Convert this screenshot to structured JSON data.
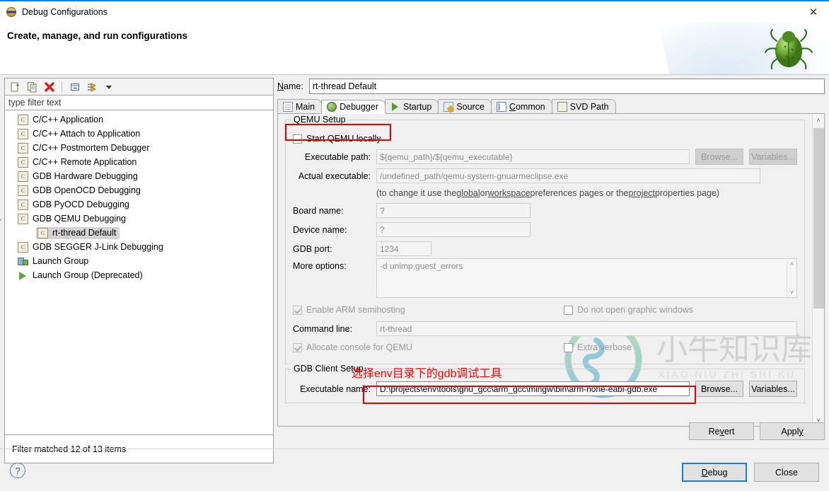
{
  "window": {
    "title": "Debug Configurations",
    "close_label": "✕",
    "header_title": "Create, manage, and run configurations",
    "header_icon": "bug-icon"
  },
  "left_panel": {
    "toolbar": [
      {
        "name": "new-configuration-icon",
        "label": ""
      },
      {
        "name": "duplicate-configuration-icon",
        "label": ""
      },
      {
        "name": "delete-configuration-icon",
        "label": ""
      },
      {
        "name": "collapse-all-icon",
        "label": ""
      },
      {
        "name": "filter-icon",
        "label": ""
      },
      {
        "name": "dropdown-arrow-icon",
        "label": ""
      }
    ],
    "filter": {
      "placeholder": "type filter text",
      "value": ""
    },
    "tree": [
      {
        "label": "C/C++ Application",
        "icon": "c-config-icon",
        "indent": 0,
        "selected": false,
        "expander": ""
      },
      {
        "label": "C/C++ Attach to Application",
        "icon": "c-config-icon",
        "indent": 0,
        "selected": false,
        "expander": ""
      },
      {
        "label": "C/C++ Postmortem Debugger",
        "icon": "c-config-icon",
        "indent": 0,
        "selected": false,
        "expander": ""
      },
      {
        "label": "C/C++ Remote Application",
        "icon": "c-config-icon",
        "indent": 0,
        "selected": false,
        "expander": ""
      },
      {
        "label": "GDB Hardware Debugging",
        "icon": "c-config-icon",
        "indent": 0,
        "selected": false,
        "expander": ""
      },
      {
        "label": "GDB OpenOCD Debugging",
        "icon": "c-config-icon",
        "indent": 0,
        "selected": false,
        "expander": ""
      },
      {
        "label": "GDB PyOCD Debugging",
        "icon": "c-config-icon",
        "indent": 0,
        "selected": false,
        "expander": ""
      },
      {
        "label": "GDB QEMU Debugging",
        "icon": "c-config-icon",
        "indent": 0,
        "selected": false,
        "expander": "expanded"
      },
      {
        "label": "rt-thread Default",
        "icon": "c-config-icon",
        "indent": 1,
        "selected": true,
        "expander": ""
      },
      {
        "label": "GDB SEGGER J-Link Debugging",
        "icon": "c-config-icon",
        "indent": 0,
        "selected": false,
        "expander": ""
      },
      {
        "label": "Launch Group",
        "icon": "launch-group-icon",
        "indent": 0,
        "selected": false,
        "expander": ""
      },
      {
        "label": "Launch Group (Deprecated)",
        "icon": "launch-group-deprecated-icon",
        "indent": 0,
        "selected": false,
        "expander": ""
      }
    ],
    "status": "Filter matched 12 of 13 items"
  },
  "right_panel": {
    "name_label": "Name:",
    "name_label_accel": "N",
    "name_value": "rt-thread Default",
    "tabs": [
      {
        "label": "Main",
        "icon": "document-icon",
        "active": false,
        "accel": ""
      },
      {
        "label": "Debugger",
        "icon": "bug-icon",
        "active": true,
        "accel": ""
      },
      {
        "label": "Startup",
        "icon": "play-icon",
        "active": false,
        "accel": ""
      },
      {
        "label": "Source",
        "icon": "source-icon",
        "active": false,
        "accel": ""
      },
      {
        "label": "Common",
        "icon": "common-icon",
        "active": false,
        "accel": "C"
      },
      {
        "label": "SVD Path",
        "icon": "svd-icon",
        "active": false,
        "accel": ""
      }
    ],
    "qemu_setup": {
      "group_label": "QEMU Setup",
      "start_qemu_locally": {
        "label": "Start QEMU locally",
        "checked": false
      },
      "executable_path": {
        "label": "Executable path:",
        "value": "${qemu_path}/${qemu_executable}"
      },
      "browse_label": "Browse...",
      "variables_label": "Variables...",
      "actual_executable": {
        "label": "Actual executable:",
        "value": "/undefined_path/qemu-system-gnuarmeclipse.exe"
      },
      "hint_prefix": "(to change it use the ",
      "hint_link1": "global",
      "hint_mid1": " or ",
      "hint_link2": "workspace",
      "hint_mid2": " preferences pages or the ",
      "hint_link3": "project",
      "hint_suffix": " properties page)",
      "board_name": {
        "label": "Board name:",
        "value": "?"
      },
      "device_name": {
        "label": "Device name:",
        "value": "?"
      },
      "gdb_port": {
        "label": "GDB port:",
        "value": "1234"
      },
      "more_options": {
        "label": "More options:",
        "value": "-d unimp,guest_errors"
      },
      "enable_arm_semihosting": {
        "label": "Enable ARM semihosting",
        "checked": true
      },
      "do_not_open_graphic_windows": {
        "label": "Do not open graphic windows",
        "checked": false
      },
      "command_line": {
        "label": "Command line:",
        "value": "rt-thread"
      },
      "allocate_console": {
        "label": "Allocate console for QEMU",
        "checked": true
      },
      "extra_verbose": {
        "label": "Extra verbose",
        "checked": false
      }
    },
    "gdb_client_setup": {
      "group_label": "GDB Client Setup",
      "executable_name": {
        "label": "Executable name:",
        "value": "D:\\projects\\env\\tools\\gnu_gcc\\arm_gcc\\mingw\\bin\\arm-none-eabi-gdb.exe"
      },
      "browse_label": "Browse...",
      "variables_label": "Variables..."
    }
  },
  "annotations": {
    "red_note": "选择env目录下的gdb调试工具",
    "red_color": "#ff0000"
  },
  "watermark": {
    "cn_text": "小牛知识库",
    "pinyin_text": "XIAO NIU ZHI SHI KU"
  },
  "footer": {
    "revert_label": "Revert",
    "revert_accel": "v",
    "apply_label": "Apply",
    "apply_accel": "y",
    "help_icon": "?",
    "debug_label": "Debug",
    "debug_accel": "D",
    "close_label": "Close"
  }
}
